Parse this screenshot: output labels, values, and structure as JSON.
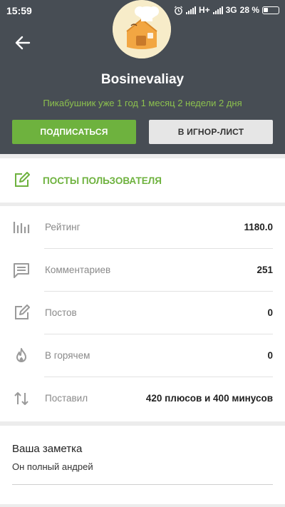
{
  "status_bar": {
    "time": "15:59",
    "network_1": "H+",
    "network_2": "3G",
    "battery": "28 %"
  },
  "header": {
    "back_icon": "arrow-left-icon",
    "avatar": "chef-house-avatar",
    "username": "Bosinevaliay",
    "membership": "Пикабушник уже 1 год 1 месяц 2 недели 2 дня",
    "subscribe_label": "ПОДПИСАТЬСЯ",
    "ignore_label": "В ИГНОР-ЛИСТ"
  },
  "posts_link": {
    "icon": "edit-icon",
    "label": "ПОСТЫ ПОЛЬЗОВАТЕЛЯ"
  },
  "stats": [
    {
      "icon": "bar-chart-icon",
      "label": "Рейтинг",
      "value": "1180.0"
    },
    {
      "icon": "comment-icon",
      "label": "Комментариев",
      "value": "251"
    },
    {
      "icon": "edit-icon",
      "label": "Постов",
      "value": "0"
    },
    {
      "icon": "fire-icon",
      "label": "В горячем",
      "value": "0"
    },
    {
      "icon": "up-down-arrows-icon",
      "label": "Поставил",
      "value": "420 плюсов и 400 минусов"
    }
  ],
  "note": {
    "title": "Ваша заметка",
    "text": "Он полный андрей"
  },
  "colors": {
    "header_bg": "#474d54",
    "accent_green": "#6eb23e",
    "membership_green": "#8cc04e"
  }
}
